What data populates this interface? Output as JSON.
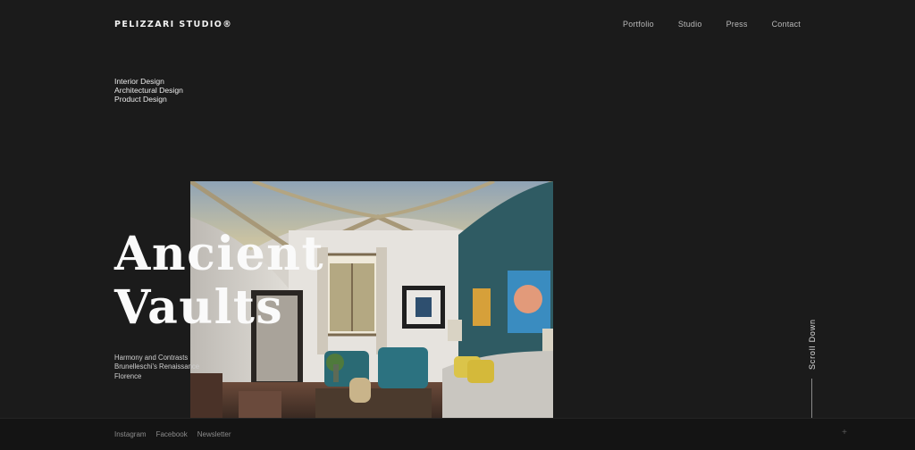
{
  "header": {
    "logo": "PELIZZARI STUDIO®",
    "nav": [
      "Portfolio",
      "Studio",
      "Press",
      "Contact"
    ]
  },
  "services": [
    "Interior Design",
    "Architectural Design",
    "Product Design"
  ],
  "hero": {
    "title_line1": "Ancient",
    "title_line2": "Vaults",
    "caption": [
      "Harmony and Contrasts",
      "Brunelleschi's Renaissance",
      "Florence"
    ]
  },
  "scroll": {
    "label": "Scroll Down"
  },
  "footer": {
    "links": [
      "Instagram",
      "Facebook",
      "Newsletter"
    ],
    "plus": "+"
  },
  "colors": {
    "background": "#1b1b1b",
    "footer": "#141414",
    "wall_teal": "#2f5b63"
  }
}
